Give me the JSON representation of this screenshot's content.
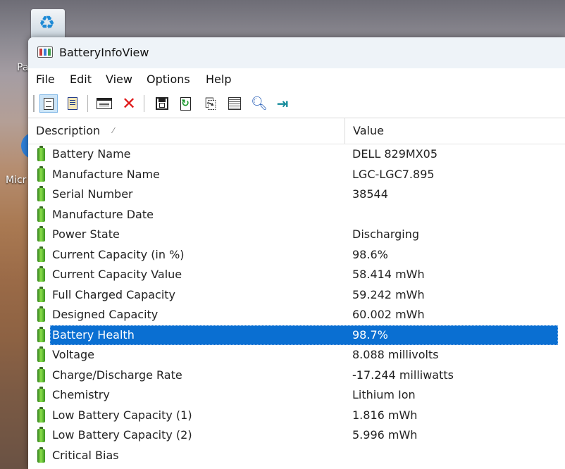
{
  "desktop": {
    "label_1": "Pa",
    "label_2": "Micr"
  },
  "window": {
    "title": "BatteryInfoView"
  },
  "menu": [
    "File",
    "Edit",
    "View",
    "Options",
    "Help"
  ],
  "toolbar": {
    "icons": [
      "html-report-icon",
      "text-report-icon",
      "properties-window-icon",
      "delete-icon",
      "save-icon",
      "refresh-icon",
      "copy-icon",
      "properties-icon",
      "find-icon",
      "exit-icon"
    ]
  },
  "list": {
    "columns": [
      "Description",
      "Value"
    ],
    "sort_indicator": "⁄",
    "selected_index": 9,
    "rows": [
      {
        "description": "Battery Name",
        "value": "DELL 829MX05"
      },
      {
        "description": "Manufacture Name",
        "value": "LGC-LGC7.895"
      },
      {
        "description": "Serial Number",
        "value": "38544"
      },
      {
        "description": "Manufacture Date",
        "value": ""
      },
      {
        "description": "Power State",
        "value": "Discharging"
      },
      {
        "description": "Current Capacity (in %)",
        "value": "98.6%"
      },
      {
        "description": "Current Capacity Value",
        "value": "58.414 mWh"
      },
      {
        "description": "Full Charged Capacity",
        "value": "59.242 mWh"
      },
      {
        "description": "Designed Capacity",
        "value": "60.002 mWh"
      },
      {
        "description": "Battery Health",
        "value": "98.7%"
      },
      {
        "description": "Voltage",
        "value": "8.088 millivolts"
      },
      {
        "description": "Charge/Discharge Rate",
        "value": "-17.244 milliwatts"
      },
      {
        "description": "Chemistry",
        "value": "Lithium Ion"
      },
      {
        "description": "Low Battery Capacity (1)",
        "value": "1.816 mWh"
      },
      {
        "description": "Low Battery Capacity (2)",
        "value": "5.996 mWh"
      },
      {
        "description": "Critical Bias",
        "value": ""
      }
    ]
  }
}
